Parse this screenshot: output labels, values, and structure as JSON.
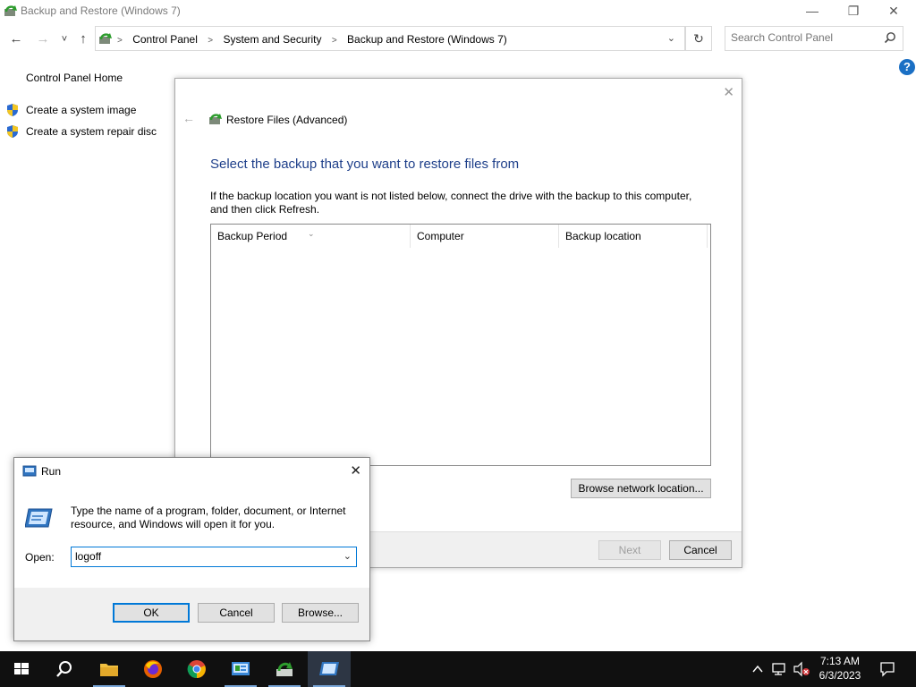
{
  "window": {
    "title": "Backup and Restore (Windows 7)",
    "minimize_glyph": "—",
    "restore_glyph": "❐",
    "close_glyph": "✕"
  },
  "address": {
    "crumbs": [
      "Control Panel",
      "System and Security",
      "Backup and Restore (Windows 7)"
    ],
    "search_placeholder": "Search Control Panel"
  },
  "nav": {
    "back_glyph": "←",
    "forward_glyph": "→",
    "recent_glyph": "˅",
    "up_glyph": "↑",
    "refresh_glyph": "↻",
    "help_glyph": "?"
  },
  "leftnav": {
    "home": "Control Panel Home",
    "items": [
      "Create a system image",
      "Create a system repair disc"
    ]
  },
  "restore": {
    "header_title": "Restore Files (Advanced)",
    "main_title": "Select the backup that you want to restore files from",
    "description": "If the backup location you want is not listed below, connect the drive with the backup to this computer, and then click Refresh.",
    "columns": [
      "Backup Period",
      "Computer",
      "Backup location"
    ],
    "browse_label": "Browse network location...",
    "next_label": "Next",
    "cancel_label": "Cancel"
  },
  "run": {
    "title": "Run",
    "message": "Type the name of a program, folder, document, or Internet resource, and Windows will open it for you.",
    "open_label": "Open:",
    "open_value": "logoff",
    "ok_label": "OK",
    "cancel_label": "Cancel",
    "browse_label": "Browse..."
  },
  "taskbar": {
    "apps": [
      "start-icon",
      "search-icon",
      "file-explorer-icon",
      "firefox-icon",
      "chrome-icon",
      "control-panel-icon",
      "backup-icon",
      "run-icon"
    ],
    "time": "7:13 AM",
    "date": "6/3/2023"
  },
  "colors": {
    "accent": "#0078d7",
    "title_blue": "#1e3f8a",
    "taskbar": "#101010"
  }
}
